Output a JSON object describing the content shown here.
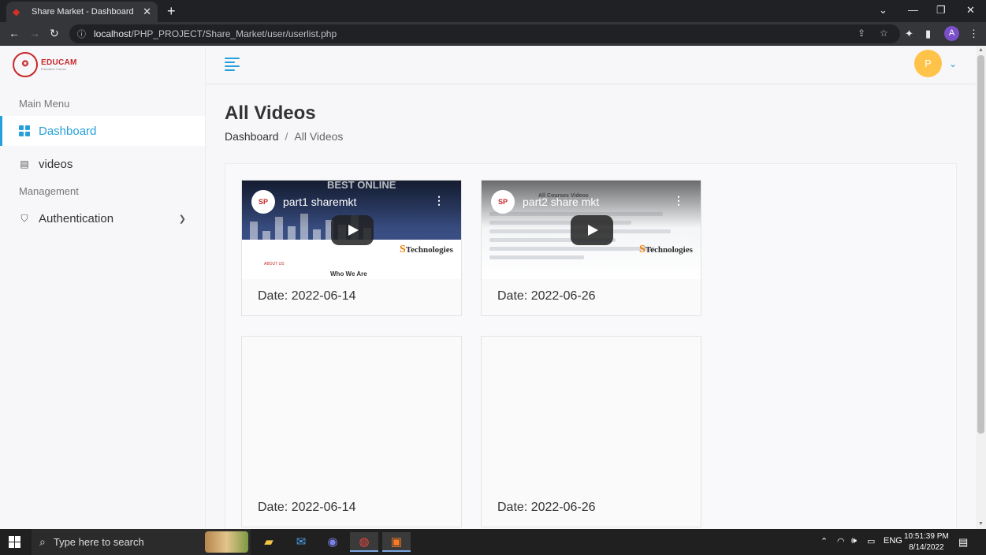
{
  "browser": {
    "tab_title": "Share Market - Dashboard",
    "url_host": "localhost",
    "url_path": "/PHP_PROJECT/Share_Market/user/userlist.php",
    "profile_initial": "A"
  },
  "logo": {
    "name": "EDUCAM",
    "subtitle": "Education Course"
  },
  "sidebar": {
    "main_menu_title": "Main Menu",
    "items": [
      {
        "label": "Dashboard",
        "icon": "grid-icon",
        "active": true
      },
      {
        "label": "videos",
        "icon": "book-icon",
        "active": false
      }
    ],
    "management_title": "Management",
    "management_items": [
      {
        "label": "Authentication",
        "icon": "shield-icon",
        "has_submenu": true
      }
    ]
  },
  "header": {
    "user_initial": "P"
  },
  "page": {
    "title": "All Videos",
    "breadcrumb": {
      "home": "Dashboard",
      "separator": "/",
      "current": "All Videos"
    }
  },
  "videos": [
    {
      "video_title": "part1 sharemkt",
      "date": "Date: 2022-06-14",
      "thumbnail_text": "BEST ONLINE",
      "who_we_are": "Who We Are",
      "about_us": "ABOUT US",
      "brand": "Technologies",
      "has_player": true
    },
    {
      "video_title": "part2 share mkt",
      "date": "Date: 2022-06-26",
      "thumbnail_text": "All Courses Videos",
      "brand": "Technologies",
      "has_player": true
    },
    {
      "date": "Date: 2022-06-14",
      "has_player": false
    },
    {
      "date": "Date: 2022-06-26",
      "has_player": false
    }
  ],
  "taskbar": {
    "search_placeholder": "Type here to search",
    "language": "ENG",
    "time": "10:51:39 PM",
    "date": "8/14/2022"
  },
  "colors": {
    "accent": "#26a0da",
    "avatar": "#ffc34a",
    "brand_red": "#c62828"
  }
}
